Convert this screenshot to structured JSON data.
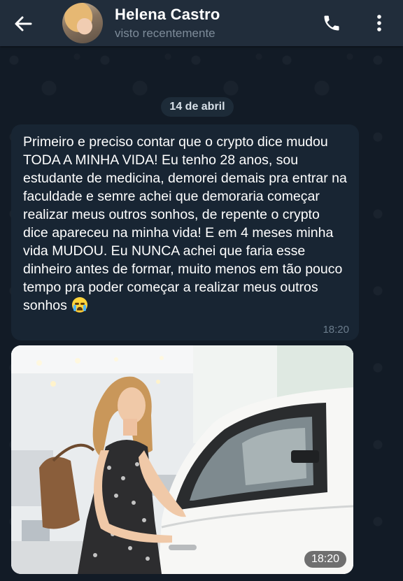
{
  "header": {
    "contact_name": "Helena Castro",
    "status": "visto recentemente",
    "icons": {
      "back": "arrow-left-icon",
      "call": "phone-icon",
      "menu": "more-vertical-icon"
    }
  },
  "chat": {
    "date_separator": "14 de abril",
    "messages": [
      {
        "type": "text",
        "text": "Primeiro e preciso contar que o crypto dice mudou TODA A MINHA VIDA! Eu tenho 28 anos, sou estudante de medicina, demorei demais pra entrar na faculdade e semre achei que demoraria começar realizar meus outros sonhos, de repente o crypto dice apareceu na minha vida! E em 4 meses minha vida MUDOU. Eu NUNCA achei que faria esse dinheiro antes de formar, muito menos em tão pouco tempo pra poder começar a realizar meus outros sonhos",
        "emoji": "loudly-crying-face",
        "time": "18:20"
      },
      {
        "type": "photo",
        "description_icon": "woman-with-white-car-photo",
        "time": "18:20"
      }
    ]
  },
  "colors": {
    "header_bg": "#212d3b",
    "chat_bg": "#0e1621",
    "bubble_bg": "#182533",
    "secondary_text": "#7d8b99"
  }
}
